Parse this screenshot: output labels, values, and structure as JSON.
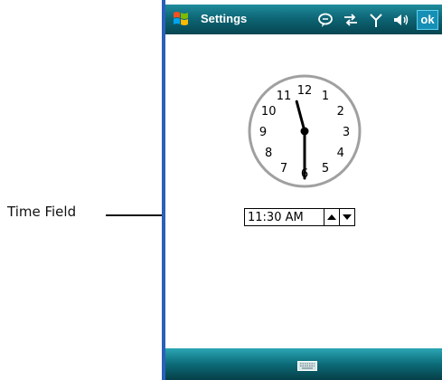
{
  "callout": {
    "label": "Time Field"
  },
  "titlebar": {
    "title": "Settings",
    "ok_label": "ok"
  },
  "tray_icons": [
    "chat-bubble-icon",
    "connectivity-arrows-icon",
    "signal-antenna-icon",
    "speaker-icon"
  ],
  "clock": {
    "numbers": [
      "12",
      "1",
      "2",
      "3",
      "4",
      "5",
      "6",
      "7",
      "8",
      "9",
      "10",
      "11"
    ],
    "hour": 11,
    "minute": 30
  },
  "time_field": {
    "value": "11:30 AM"
  },
  "bottombar": {
    "icon": "keyboard-icon"
  },
  "colors": {
    "titlebar": "#0e6676",
    "accent": "#168fb5",
    "bezel": "#2b5fb9"
  }
}
